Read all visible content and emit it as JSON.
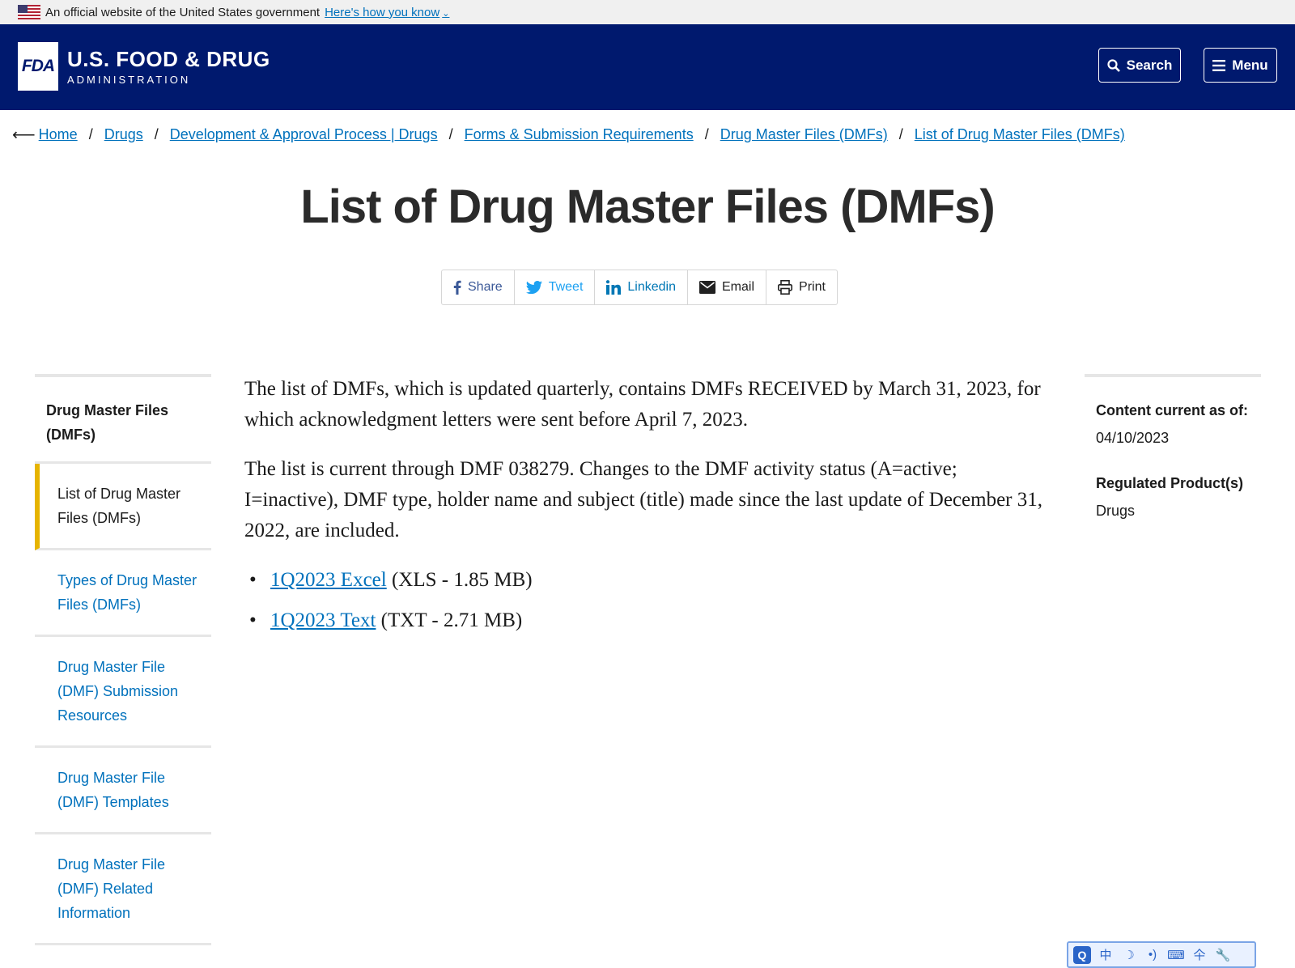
{
  "gov_banner": {
    "text": "An official website of the United States government",
    "link": "Here's how you know"
  },
  "header": {
    "logo_text": "FDA",
    "agency_line1": "U.S. FOOD & DRUG",
    "agency_line2": "ADMINISTRATION",
    "search_label": "Search",
    "menu_label": "Menu",
    "bg_color": "#00196e"
  },
  "breadcrumb": [
    "Home",
    "Drugs",
    "Development & Approval Process | Drugs",
    "Forms & Submission Requirements",
    "Drug Master Files (DMFs)",
    "List of Drug Master Files (DMFs)"
  ],
  "title": "List of Drug Master Files (DMFs)",
  "share": {
    "share": "Share",
    "tweet": "Tweet",
    "linkedin": "Linkedin",
    "email": "Email",
    "print": "Print"
  },
  "sidebar": {
    "heading": "Drug Master Files (DMFs)",
    "items": [
      "List of Drug Master Files (DMFs)",
      "Types of Drug Master Files (DMFs)",
      "Drug Master File (DMF) Submission Resources",
      "Drug Master File (DMF) Templates",
      "Drug Master File (DMF) Related Information"
    ],
    "active_index": 0,
    "active_color": "#e6b400"
  },
  "main": {
    "paragraph1": "The list of DMFs, which is updated quarterly, contains DMFs RECEIVED by March 31, 2023, for which acknowledgment letters were sent before April 7, 2023.",
    "paragraph2": "The list is current through DMF 038279. Changes to the DMF activity status (A=active; I=inactive), DMF type, holder name and subject (title) made since the last update of December 31, 2022, are included.",
    "downloads": [
      {
        "link": "1Q2023 Excel",
        "meta": "(XLS - 1.85 MB)"
      },
      {
        "link": "1Q2023 Text",
        "meta": "(TXT - 2.71 MB)"
      }
    ]
  },
  "rightcol": {
    "content_label": "Content current as of:",
    "content_date": "04/10/2023",
    "regulated_label": "Regulated Product(s)",
    "regulated_value": "Drugs"
  },
  "ime_toolbar": {
    "logo": "Q",
    "items": [
      "中",
      "☽",
      "•)",
      "⌨",
      "仐",
      "🔧"
    ]
  }
}
